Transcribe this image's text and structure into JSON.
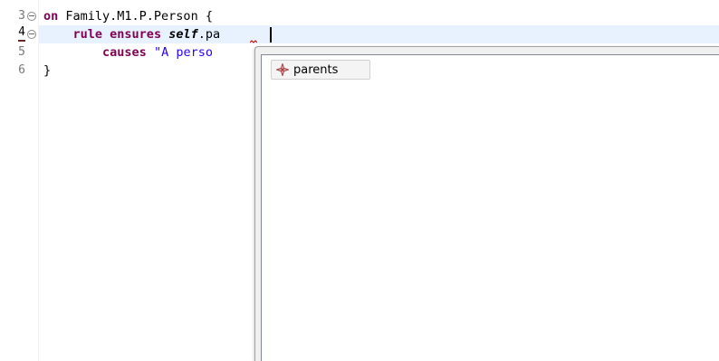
{
  "editor": {
    "gutter": [
      {
        "number": "3",
        "folded": true,
        "current": false
      },
      {
        "number": "4",
        "folded": true,
        "current": true
      },
      {
        "number": "5",
        "folded": false,
        "current": false
      },
      {
        "number": "6",
        "folded": false,
        "current": false
      }
    ],
    "lines": [
      {
        "parts": [
          "on",
          " Family.M1.P.Person {"
        ]
      },
      {
        "parts": [
          "    ",
          "rule",
          " ",
          "ensures",
          " ",
          "self",
          ".pa"
        ]
      },
      {
        "parts": [
          "        ",
          "causes",
          " ",
          "\"A perso"
        ]
      },
      {
        "parts": [
          "}"
        ]
      }
    ]
  },
  "content_assist": {
    "proposals": [
      {
        "label": "parents",
        "icon": "feature-icon"
      }
    ]
  },
  "colors": {
    "keyword": "#7f0055",
    "string": "#2a00ff",
    "current_line": "#e8f2fe",
    "error": "#d00000"
  }
}
